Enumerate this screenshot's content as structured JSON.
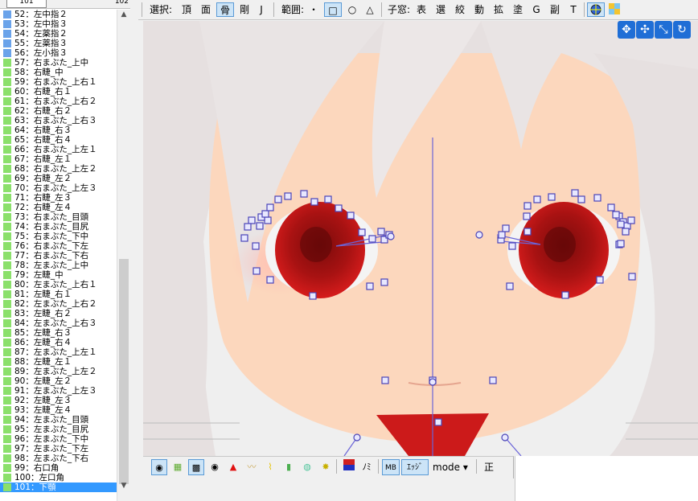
{
  "list": {
    "header_left": "101",
    "header_right": "102",
    "items": [
      {
        "label": "52：左中指２",
        "mark": "b"
      },
      {
        "label": "53：左中指３",
        "mark": "b"
      },
      {
        "label": "54：左薬指２",
        "mark": "b"
      },
      {
        "label": "55：左薬指３",
        "mark": "b"
      },
      {
        "label": "56：左小指３",
        "mark": "b"
      },
      {
        "label": "57：右まぶた_上中",
        "mark": "g"
      },
      {
        "label": "58：右睫_中",
        "mark": "g"
      },
      {
        "label": "59：右まぶた_上右１",
        "mark": "g"
      },
      {
        "label": "60：右睫_右１",
        "mark": "g"
      },
      {
        "label": "61：右まぶた_上右２",
        "mark": "g"
      },
      {
        "label": "62：右睫_右２",
        "mark": "g"
      },
      {
        "label": "63：右まぶた_上右３",
        "mark": "g"
      },
      {
        "label": "64：右睫_右３",
        "mark": "g"
      },
      {
        "label": "65：右睫_右４",
        "mark": "g"
      },
      {
        "label": "66：右まぶた_上左１",
        "mark": "g"
      },
      {
        "label": "67：右睫_左１",
        "mark": "g"
      },
      {
        "label": "68：右まぶた_上左２",
        "mark": "g"
      },
      {
        "label": "69：右睫_左２",
        "mark": "g"
      },
      {
        "label": "70：右まぶた_上左３",
        "mark": "g"
      },
      {
        "label": "71：右睫_左３",
        "mark": "g"
      },
      {
        "label": "72：右睫_左４",
        "mark": "g"
      },
      {
        "label": "73：右まぶた_目頭",
        "mark": "g"
      },
      {
        "label": "74：右まぶた_目尻",
        "mark": "g"
      },
      {
        "label": "75：右まぶた_下中",
        "mark": "g"
      },
      {
        "label": "76：右まぶた_下左",
        "mark": "g"
      },
      {
        "label": "77：右まぶた_下右",
        "mark": "g"
      },
      {
        "label": "78：左まぶた_上中",
        "mark": "g"
      },
      {
        "label": "79：左睫_中",
        "mark": "g"
      },
      {
        "label": "80：左まぶた_上右１",
        "mark": "g"
      },
      {
        "label": "81：左睫_右１",
        "mark": "g"
      },
      {
        "label": "82：左まぶた_上右２",
        "mark": "g"
      },
      {
        "label": "83：左睫_右２",
        "mark": "g"
      },
      {
        "label": "84：左まぶた_上右３",
        "mark": "g"
      },
      {
        "label": "85：左睫_右３",
        "mark": "g"
      },
      {
        "label": "86：左睫_右４",
        "mark": "g"
      },
      {
        "label": "87：左まぶた_上左１",
        "mark": "g"
      },
      {
        "label": "88：左睫_左１",
        "mark": "g"
      },
      {
        "label": "89：左まぶた_上左２",
        "mark": "g"
      },
      {
        "label": "90：左睫_左２",
        "mark": "g"
      },
      {
        "label": "91：左まぶた_上左３",
        "mark": "g"
      },
      {
        "label": "92：左睫_左３",
        "mark": "g"
      },
      {
        "label": "93：左睫_左４",
        "mark": "g"
      },
      {
        "label": "94：左まぶた_目頭",
        "mark": "g"
      },
      {
        "label": "95：左まぶた_目尻",
        "mark": "g"
      },
      {
        "label": "96：左まぶた_下中",
        "mark": "g"
      },
      {
        "label": "97：左まぶた_下左",
        "mark": "g"
      },
      {
        "label": "98：左まぶた_下右",
        "mark": "g"
      },
      {
        "label": "99：右口角",
        "mark": "g"
      },
      {
        "label": "100：左口角",
        "mark": "g"
      },
      {
        "label": "101：下顎",
        "mark": "g",
        "selected": true
      }
    ]
  },
  "toolbar": {
    "select_label": "選択:",
    "vertex": "頂",
    "face": "面",
    "bone": "骨",
    "rigid": "剛",
    "joint": "J",
    "range_label": "範囲:",
    "range_point": "・",
    "range_rect": "□",
    "range_circle": "○",
    "range_tri": "△",
    "subwin_label": "子窓:",
    "sub_table": "表",
    "sub_select": "選",
    "sub_filter": "絞",
    "sub_move": "動",
    "sub_scale": "拡",
    "sub_paint": "塗",
    "sub_g": "G",
    "sub_sub": "副",
    "sub_t": "T"
  },
  "bottombar": {
    "nomi_label": "ﾉﾐ",
    "mb_label": "MB",
    "edge_label": "ｴｯｼﾞ",
    "mode_value": "mode",
    "sei_label": "正"
  },
  "colors": {
    "bone_line": "#6a64d8",
    "selected_row": "#3399ff",
    "toolbar_active": "#cce4f7"
  }
}
